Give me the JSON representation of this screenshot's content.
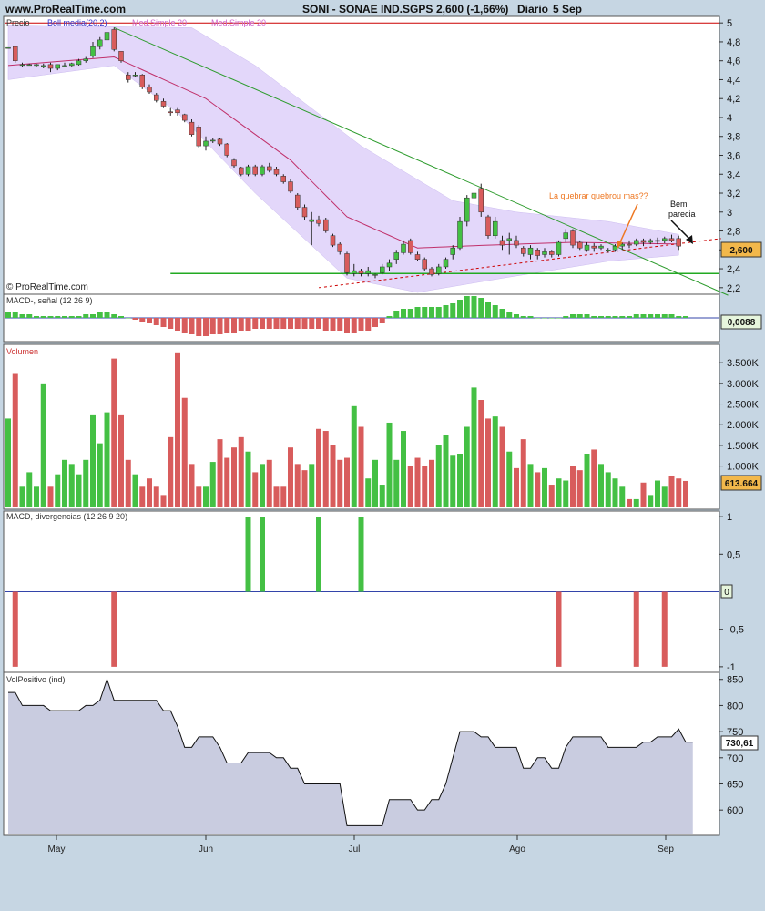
{
  "header": {
    "site": "www.ProRealTime.com",
    "title": "SONI - SONAE IND.SGPS",
    "quote": "2,600 (-1,66%)",
    "period": "Diario",
    "date": "5 Sep"
  },
  "panels": {
    "price": {
      "label": "Precio",
      "indicators": [
        "Boll media(20,2)",
        "Med.Simple 20",
        "Med.Simple 20"
      ],
      "yticks": [
        "5",
        "4,8",
        "4,6",
        "4,4",
        "4,2",
        "4",
        "3,8",
        "3,6",
        "3,4",
        "3,2",
        "3",
        "2,8",
        "2,6",
        "2,4",
        "2,2"
      ],
      "last_value": "2,600",
      "copyright": "© ProRealTime.com",
      "annotations": [
        "La quebrar quebrou mas??",
        "Bem",
        "parecia"
      ]
    },
    "macd": {
      "label": "MACD-, señal (12 26 9)",
      "last_value": "0,0088"
    },
    "volume": {
      "label": "Volumen",
      "yticks": [
        "3.500K",
        "3.000K",
        "2.500K",
        "2.000K",
        "1.500K",
        "1.000K"
      ],
      "last_value": "613.664"
    },
    "divergence": {
      "label": "MACD, divergencias (12 26 9 20)",
      "yticks": [
        "1",
        "0,5",
        "-0,5",
        "-1"
      ],
      "zero_label": "0"
    },
    "volpos": {
      "label": "VolPositivo (ind)",
      "yticks": [
        "850",
        "800",
        "750",
        "700",
        "650",
        "600"
      ],
      "last_value": "730,61"
    }
  },
  "x_axis": {
    "labels": [
      "May",
      "Jun",
      "Jul",
      "Ago",
      "Sep"
    ]
  },
  "colors": {
    "background": "#c6d6e3",
    "up": "#44c044",
    "down": "#d85c5c",
    "boll_band": "#e3d7fa",
    "trendline": "#2e9c2e",
    "support": "#22aa22",
    "resistance": "#cc0000",
    "annotation": "#ee7722"
  },
  "chart_data": [
    {
      "panel": "price",
      "type": "candlestick",
      "title": "SONI - SONAE IND.SGPS",
      "ylim": [
        2.15,
        5.05
      ],
      "last": 2.6,
      "candles": [
        [
          4.74,
          4.74,
          4.74,
          4.74
        ],
        [
          4.75,
          4.75,
          4.58,
          4.6
        ],
        [
          4.56,
          4.58,
          4.53,
          4.56
        ],
        [
          4.56,
          4.57,
          4.55,
          4.56
        ],
        [
          4.55,
          4.57,
          4.53,
          4.56
        ],
        [
          4.54,
          4.57,
          4.52,
          4.55
        ],
        [
          4.56,
          4.58,
          4.48,
          4.52
        ],
        [
          4.52,
          4.56,
          4.5,
          4.56
        ],
        [
          4.55,
          4.58,
          4.53,
          4.55
        ],
        [
          4.55,
          4.58,
          4.54,
          4.57
        ],
        [
          4.56,
          4.62,
          4.55,
          4.6
        ],
        [
          4.6,
          4.64,
          4.58,
          4.62
        ],
        [
          4.65,
          4.8,
          4.63,
          4.75
        ],
        [
          4.75,
          4.85,
          4.72,
          4.82
        ],
        [
          4.82,
          4.92,
          4.8,
          4.9
        ],
        [
          4.93,
          4.95,
          4.7,
          4.72
        ],
        [
          4.7,
          4.7,
          4.58,
          4.6
        ],
        [
          4.45,
          4.48,
          4.37,
          4.4
        ],
        [
          4.45,
          4.48,
          4.43,
          4.45
        ],
        [
          4.45,
          4.46,
          4.3,
          4.32
        ],
        [
          4.32,
          4.35,
          4.25,
          4.27
        ],
        [
          4.24,
          4.26,
          4.16,
          4.18
        ],
        [
          4.17,
          4.2,
          4.1,
          4.12
        ],
        [
          4.06,
          4.1,
          4.02,
          4.05
        ],
        [
          4.08,
          4.1,
          4.02,
          4.05
        ],
        [
          4.03,
          4.04,
          3.95,
          3.97
        ],
        [
          3.95,
          3.98,
          3.8,
          3.82
        ],
        [
          3.9,
          3.92,
          3.68,
          3.7
        ],
        [
          3.7,
          3.8,
          3.65,
          3.75
        ],
        [
          3.75,
          3.78,
          3.73,
          3.76
        ],
        [
          3.77,
          3.78,
          3.7,
          3.72
        ],
        [
          3.72,
          3.73,
          3.58,
          3.6
        ],
        [
          3.55,
          3.57,
          3.47,
          3.49
        ],
        [
          3.47,
          3.48,
          3.38,
          3.4
        ],
        [
          3.4,
          3.5,
          3.38,
          3.48
        ],
        [
          3.48,
          3.5,
          3.38,
          3.4
        ],
        [
          3.4,
          3.5,
          3.38,
          3.48
        ],
        [
          3.48,
          3.52,
          3.42,
          3.44
        ],
        [
          3.45,
          3.48,
          3.38,
          3.4
        ],
        [
          3.38,
          3.4,
          3.3,
          3.32
        ],
        [
          3.32,
          3.35,
          3.2,
          3.22
        ],
        [
          3.18,
          3.2,
          3.02,
          3.05
        ],
        [
          3.05,
          3.08,
          2.92,
          2.95
        ],
        [
          2.9,
          3.0,
          2.65,
          2.92
        ],
        [
          2.92,
          2.96,
          2.85,
          2.88
        ],
        [
          2.92,
          2.94,
          2.78,
          2.8
        ],
        [
          2.75,
          2.77,
          2.63,
          2.65
        ],
        [
          2.66,
          2.68,
          2.55,
          2.58
        ],
        [
          2.56,
          2.58,
          2.33,
          2.36
        ],
        [
          2.35,
          2.45,
          2.32,
          2.38
        ],
        [
          2.38,
          2.4,
          2.32,
          2.35
        ],
        [
          2.35,
          2.42,
          2.32,
          2.38
        ],
        [
          2.33,
          2.35,
          2.3,
          2.34
        ],
        [
          2.36,
          2.45,
          2.34,
          2.42
        ],
        [
          2.42,
          2.5,
          2.38,
          2.46
        ],
        [
          2.5,
          2.6,
          2.45,
          2.57
        ],
        [
          2.57,
          2.7,
          2.55,
          2.66
        ],
        [
          2.7,
          2.72,
          2.55,
          2.57
        ],
        [
          2.55,
          2.58,
          2.48,
          2.5
        ],
        [
          2.5,
          2.52,
          2.38,
          2.4
        ],
        [
          2.4,
          2.42,
          2.32,
          2.34
        ],
        [
          2.35,
          2.45,
          2.33,
          2.42
        ],
        [
          2.42,
          2.52,
          2.4,
          2.5
        ],
        [
          2.55,
          2.65,
          2.5,
          2.62
        ],
        [
          2.62,
          2.95,
          2.6,
          2.9
        ],
        [
          2.9,
          3.18,
          2.85,
          3.15
        ],
        [
          3.15,
          3.32,
          3.12,
          3.2
        ],
        [
          3.25,
          3.3,
          2.95,
          3.0
        ],
        [
          2.95,
          2.97,
          2.72,
          2.75
        ],
        [
          2.75,
          2.95,
          2.72,
          2.9
        ],
        [
          2.7,
          2.75,
          2.6,
          2.65
        ],
        [
          2.7,
          2.78,
          2.55,
          2.72
        ],
        [
          2.7,
          2.75,
          2.62,
          2.65
        ],
        [
          2.62,
          2.64,
          2.53,
          2.56
        ],
        [
          2.55,
          2.65,
          2.5,
          2.62
        ],
        [
          2.6,
          2.62,
          2.5,
          2.54
        ],
        [
          2.55,
          2.62,
          2.52,
          2.58
        ],
        [
          2.58,
          2.6,
          2.52,
          2.55
        ],
        [
          2.55,
          2.7,
          2.53,
          2.68
        ],
        [
          2.72,
          2.82,
          2.68,
          2.78
        ],
        [
          2.8,
          2.82,
          2.62,
          2.65
        ],
        [
          2.68,
          2.7,
          2.6,
          2.62
        ],
        [
          2.6,
          2.68,
          2.58,
          2.65
        ],
        [
          2.64,
          2.67,
          2.58,
          2.62
        ],
        [
          2.62,
          2.66,
          2.6,
          2.64
        ],
        [
          2.6,
          2.62,
          2.57,
          2.6
        ],
        [
          2.6,
          2.66,
          2.58,
          2.64
        ],
        [
          2.64,
          2.68,
          2.6,
          2.66
        ],
        [
          2.66,
          2.7,
          2.62,
          2.65
        ],
        [
          2.66,
          2.72,
          2.64,
          2.7
        ],
        [
          2.7,
          2.72,
          2.64,
          2.68
        ],
        [
          2.68,
          2.72,
          2.66,
          2.7
        ],
        [
          2.7,
          2.73,
          2.66,
          2.7
        ],
        [
          2.7,
          2.74,
          2.67,
          2.72
        ],
        [
          2.72,
          2.76,
          2.68,
          2.7
        ],
        [
          2.72,
          2.75,
          2.6,
          2.64
        ]
      ],
      "boll_upper": [
        [
          0,
          4.98
        ],
        [
          15,
          4.96
        ],
        [
          26,
          4.95
        ],
        [
          35,
          4.55
        ],
        [
          50,
          3.7
        ],
        [
          63,
          3.12
        ],
        [
          72,
          3.0
        ],
        [
          85,
          2.9
        ],
        [
          96,
          2.75
        ]
      ],
      "boll_lower": [
        [
          0,
          4.4
        ],
        [
          15,
          4.55
        ],
        [
          24,
          4.05
        ],
        [
          35,
          3.2
        ],
        [
          48,
          2.3
        ],
        [
          58,
          2.15
        ],
        [
          70,
          2.3
        ],
        [
          85,
          2.48
        ],
        [
          96,
          2.55
        ]
      ],
      "moving_average": [
        [
          0,
          4.55
        ],
        [
          15,
          4.64
        ],
        [
          28,
          4.2
        ],
        [
          40,
          3.55
        ],
        [
          48,
          2.95
        ],
        [
          58,
          2.62
        ],
        [
          68,
          2.65
        ],
        [
          80,
          2.68
        ],
        [
          96,
          2.66
        ]
      ],
      "trendline": [
        [
          15,
          4.95
        ],
        [
          102,
          2.12
        ]
      ],
      "support": {
        "from": 23,
        "value": 2.35
      },
      "resistance": {
        "value": 5.0
      },
      "dashed_support": [
        [
          44,
          2.2
        ],
        [
          101,
          2.72
        ]
      ]
    },
    {
      "panel": "macd",
      "type": "bar",
      "ylim": [
        -0.12,
        0.12
      ],
      "values": [
        0.03,
        0.03,
        0.02,
        0.02,
        0.01,
        0.01,
        0.01,
        0.01,
        0.01,
        0.01,
        0.01,
        0.02,
        0.02,
        0.03,
        0.03,
        0.02,
        0.01,
        0,
        -0.01,
        -0.02,
        -0.03,
        -0.04,
        -0.05,
        -0.06,
        -0.07,
        -0.08,
        -0.09,
        -0.1,
        -0.1,
        -0.09,
        -0.09,
        -0.08,
        -0.08,
        -0.07,
        -0.07,
        -0.06,
        -0.06,
        -0.06,
        -0.06,
        -0.06,
        -0.06,
        -0.06,
        -0.06,
        -0.06,
        -0.06,
        -0.07,
        -0.07,
        -0.07,
        -0.08,
        -0.08,
        -0.07,
        -0.07,
        -0.05,
        -0.03,
        0.01,
        0.04,
        0.05,
        0.05,
        0.06,
        0.06,
        0.06,
        0.06,
        0.07,
        0.08,
        0.1,
        0.12,
        0.12,
        0.11,
        0.09,
        0.07,
        0.05,
        0.03,
        0.02,
        0.01,
        0.01,
        0,
        0,
        0,
        0,
        0.01,
        0.02,
        0.02,
        0.02,
        0.01,
        0.01,
        0.01,
        0.01,
        0.01,
        0.01,
        0.02,
        0.02,
        0.02,
        0.02,
        0.02,
        0.02,
        0.01,
        0.01
      ],
      "last": 0.0088
    },
    {
      "panel": "volume",
      "type": "bar",
      "unit": "K",
      "ylim": [
        0,
        3900
      ],
      "values": [
        2150,
        3250,
        500,
        850,
        500,
        3000,
        500,
        800,
        1150,
        1050,
        800,
        1150,
        2250,
        1550,
        2300,
        3600,
        2250,
        1150,
        800,
        500,
        700,
        500,
        300,
        1700,
        3750,
        2650,
        1050,
        500,
        500,
        1100,
        1650,
        1200,
        1450,
        1700,
        1350,
        850,
        1050,
        1150,
        500,
        500,
        1450,
        1050,
        900,
        1050,
        1900,
        1850,
        1500,
        1150,
        1200,
        2450,
        1950,
        700,
        1150,
        550,
        2050,
        1150,
        1850,
        1000,
        1200,
        1000,
        1150,
        1500,
        1750,
        1250,
        1300,
        1950,
        2900,
        2600,
        2150,
        2200,
        1950,
        1350,
        950,
        1650,
        1050,
        850,
        950,
        550,
        700,
        650,
        1000,
        900,
        1300,
        1400,
        1050,
        850,
        700,
        500,
        200,
        200,
        600,
        300,
        650,
        500,
        750,
        700,
        640
      ],
      "last": 613.664
    },
    {
      "panel": "divergence",
      "type": "bar",
      "ylim": [
        -1.05,
        1.05
      ],
      "values": [
        0,
        -1,
        0,
        0,
        0,
        0,
        0,
        0,
        0,
        0,
        0,
        0,
        0,
        0,
        0,
        -1,
        0,
        0,
        0,
        0,
        0,
        0,
        0,
        0,
        0,
        0,
        0,
        0,
        0,
        0,
        0,
        0,
        0,
        0,
        1,
        0,
        1,
        0,
        0,
        0,
        0,
        0,
        0,
        0,
        1,
        0,
        0,
        0,
        0,
        0,
        1,
        0,
        0,
        0,
        0,
        0,
        0,
        0,
        0,
        0,
        0,
        0,
        0,
        0,
        0,
        0,
        0,
        0,
        0,
        0,
        0,
        0,
        0,
        0,
        0,
        0,
        0,
        0,
        -1,
        0,
        0,
        0,
        0,
        0,
        0,
        0,
        0,
        0,
        0,
        -1,
        0,
        0,
        0,
        -1,
        0,
        0
      ]
    },
    {
      "panel": "volpos",
      "type": "area",
      "ylim": [
        555,
        860
      ],
      "values": [
        825,
        825,
        800,
        800,
        800,
        800,
        790,
        790,
        790,
        790,
        790,
        800,
        800,
        810,
        850,
        810,
        810,
        810,
        810,
        810,
        810,
        810,
        790,
        790,
        760,
        720,
        720,
        740,
        740,
        740,
        720,
        690,
        690,
        690,
        710,
        710,
        710,
        710,
        700,
        700,
        680,
        680,
        650,
        650,
        650,
        650,
        650,
        650,
        570,
        570,
        570,
        570,
        570,
        570,
        620,
        620,
        620,
        620,
        600,
        600,
        620,
        620,
        650,
        700,
        750,
        750,
        750,
        740,
        740,
        720,
        720,
        720,
        720,
        680,
        680,
        700,
        700,
        680,
        680,
        720,
        740,
        740,
        740,
        740,
        740,
        720,
        720,
        720,
        720,
        720,
        730,
        730,
        740,
        740,
        740,
        755,
        730,
        730
      ]
    }
  ]
}
